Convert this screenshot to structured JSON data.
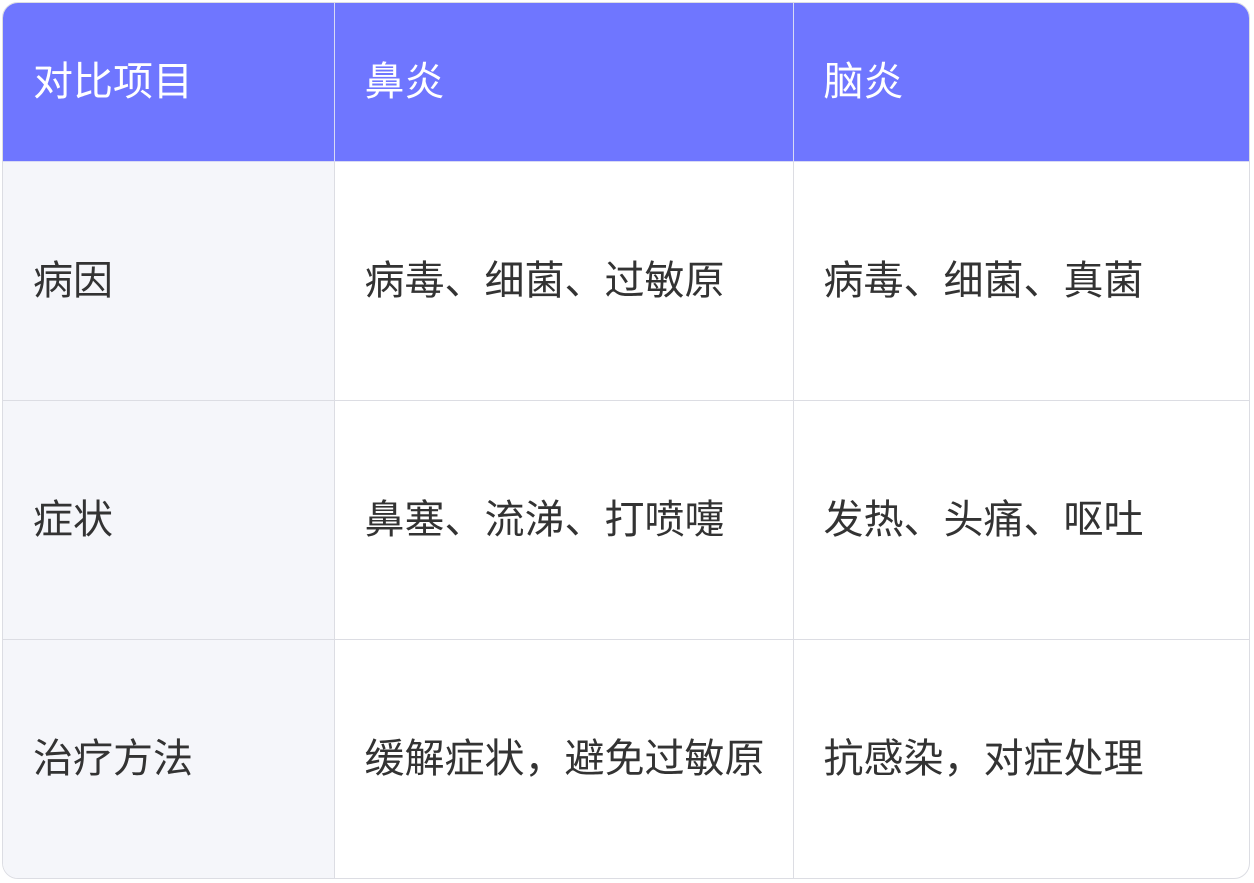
{
  "table": {
    "headers": [
      "对比项目",
      "鼻炎",
      "脑炎"
    ],
    "rows": [
      [
        "病因",
        "病毒、细菌、过敏原",
        "病毒、细菌、真菌"
      ],
      [
        "症状",
        "鼻塞、流涕、打喷嚏",
        "发热、头痛、呕吐"
      ],
      [
        "治疗方法",
        "缓解症状，避免过敏原",
        "抗感染，对症处理"
      ]
    ]
  },
  "colors": {
    "header_background": "#6f76ff",
    "header_text": "#ffffff",
    "row_head_background": "#f5f6fa",
    "border": "#dcdde3",
    "text": "#333333"
  }
}
